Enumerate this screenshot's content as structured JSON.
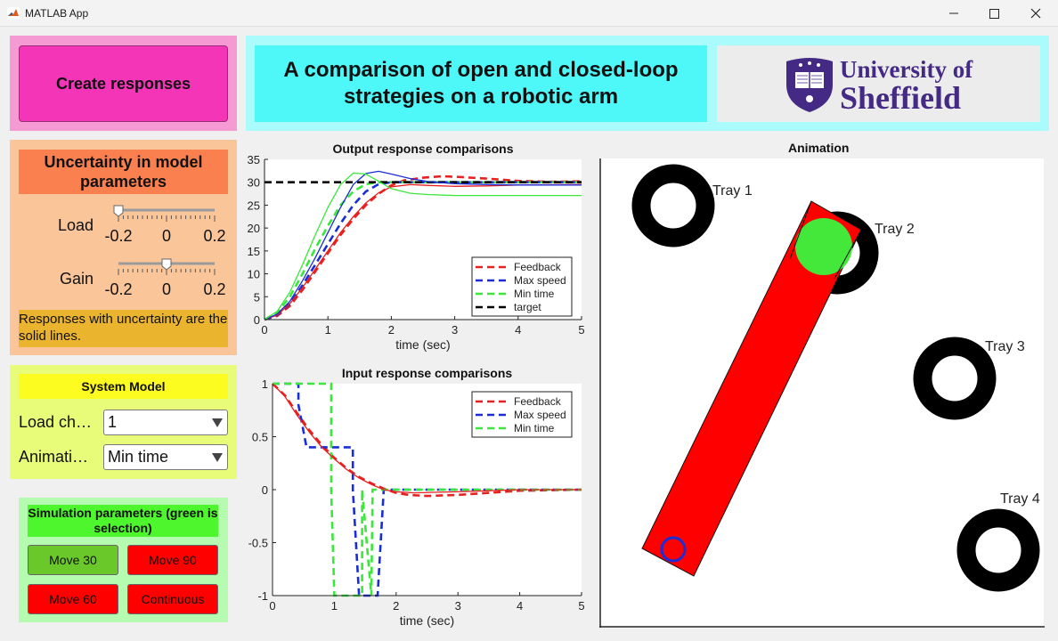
{
  "window": {
    "title": "MATLAB App"
  },
  "create_button": {
    "label": "Create responses"
  },
  "uncertainty": {
    "heading": "Uncertainty in model parameters",
    "load_label": "Load",
    "gain_label": "Gain",
    "slider_ticks": [
      "-0.2",
      "0",
      "0.2"
    ],
    "load_value": -0.2,
    "gain_value": 0,
    "note": "Responses with uncertainty are the solid lines."
  },
  "system_model": {
    "heading": "System Model",
    "load_label": "Load ch…",
    "load_value": "1",
    "anim_label": "Animati…",
    "anim_value": "Min time"
  },
  "simulation": {
    "heading": "Simulation parameters (green is selection)",
    "buttons": [
      "Move 30",
      "Move 90",
      "Move 60",
      "Continuous"
    ],
    "colors": {
      "selected": "#6ac82b",
      "unselected": "#ff0000"
    }
  },
  "header": {
    "title": "A comparison of open and closed-loop strategies on a robotic arm",
    "logo_line1": "University of",
    "logo_line2": "Sheffield"
  },
  "colors": {
    "feedback": "#e82020",
    "max_speed": "#1a2ed8",
    "min_time": "#3ae83a",
    "target": "#000000"
  },
  "chart_data": [
    {
      "type": "line",
      "title": "Output response comparisons",
      "xlabel": "time (sec)",
      "ylabel": "",
      "xlim": [
        0,
        5
      ],
      "ylim": [
        0,
        35
      ],
      "xticks": [
        "0",
        "1",
        "2",
        "3",
        "4",
        "5"
      ],
      "yticks": [
        "0",
        "5",
        "10",
        "15",
        "20",
        "25",
        "30",
        "35"
      ],
      "legend": [
        "Feedback",
        "Max speed",
        "Min time",
        "target"
      ],
      "legend_position": "bottom-right",
      "series": [
        {
          "name": "Feedback",
          "style": "dashed",
          "x": [
            0,
            0.2,
            0.4,
            0.6,
            0.8,
            1.0,
            1.2,
            1.4,
            1.6,
            1.8,
            2.0,
            2.2,
            2.5,
            2.8,
            3.0,
            3.5,
            4.0,
            4.5,
            5.0
          ],
          "y": [
            0,
            0.8,
            3,
            6.5,
            10.5,
            14.5,
            18.5,
            22,
            25,
            27.5,
            29.3,
            30.4,
            31,
            31.3,
            31.2,
            30.8,
            30.3,
            30.1,
            30.2
          ]
        },
        {
          "name": "Max speed",
          "style": "dashed",
          "x": [
            0,
            0.2,
            0.4,
            0.6,
            0.8,
            1.0,
            1.2,
            1.4,
            1.6,
            1.8,
            2.0,
            2.5,
            3.0,
            4.0,
            5.0
          ],
          "y": [
            0,
            1,
            3.5,
            7.5,
            12,
            16.5,
            21,
            25,
            28,
            29.6,
            30,
            30,
            30,
            30,
            30
          ]
        },
        {
          "name": "Min time",
          "style": "dashed",
          "x": [
            0,
            0.2,
            0.4,
            0.6,
            0.8,
            1.0,
            1.2,
            1.4,
            1.6,
            1.8,
            2.0,
            2.5,
            3.0,
            4.0,
            5.0
          ],
          "y": [
            0,
            1.5,
            5,
            10,
            15.5,
            20.5,
            25,
            28,
            29.6,
            30,
            30,
            30,
            30,
            30,
            30
          ]
        },
        {
          "name": "target",
          "style": "dashed",
          "x": [
            0,
            5
          ],
          "y": [
            30,
            30
          ]
        },
        {
          "name": "Feedback (uncertain)",
          "style": "solid",
          "x": [
            0,
            0.2,
            0.4,
            0.6,
            0.8,
            1.0,
            1.2,
            1.4,
            1.6,
            1.8,
            2.0,
            2.3,
            2.6,
            3.0,
            3.5,
            4.0,
            5.0
          ],
          "y": [
            0,
            1,
            3.5,
            7,
            11,
            15,
            19,
            22.5,
            25.5,
            27.7,
            29,
            29.5,
            29.3,
            29.1,
            29.2,
            29.4,
            29.5
          ]
        },
        {
          "name": "Max speed (uncertain)",
          "style": "solid",
          "x": [
            0,
            0.2,
            0.4,
            0.6,
            0.8,
            1.0,
            1.2,
            1.4,
            1.6,
            1.8,
            2.0,
            2.3,
            2.6,
            3.0,
            3.5,
            4.0,
            5.0
          ],
          "y": [
            0,
            1.2,
            4,
            8.5,
            13.5,
            19,
            24.5,
            29.5,
            31.9,
            32.4,
            31.8,
            30.8,
            30.1,
            29.7,
            29.5,
            29.4,
            29.4
          ]
        },
        {
          "name": "Min time (uncertain)",
          "style": "solid",
          "x": [
            0,
            0.2,
            0.4,
            0.6,
            0.8,
            1.0,
            1.2,
            1.4,
            1.6,
            1.8,
            2.0,
            2.3,
            2.6,
            3.0,
            3.5,
            4.0,
            5.0
          ],
          "y": [
            0,
            1.8,
            6,
            12,
            18.5,
            24.5,
            29.5,
            32,
            31.8,
            30.2,
            28.6,
            27.6,
            27.3,
            27.1,
            27.1,
            27.1,
            27.1
          ]
        }
      ]
    },
    {
      "type": "line",
      "title": "Input response comparisons",
      "xlabel": "time (sec)",
      "ylabel": "",
      "xlim": [
        0,
        5
      ],
      "ylim": [
        -1,
        1
      ],
      "xticks": [
        "0",
        "1",
        "2",
        "3",
        "4",
        "5"
      ],
      "yticks": [
        "-1",
        "-0.5",
        "0",
        "0.5",
        "1"
      ],
      "legend": [
        "Feedback",
        "Max speed",
        "Min time"
      ],
      "legend_position": "top-right",
      "series": [
        {
          "name": "Feedback",
          "style": "dashed",
          "x": [
            0,
            0.2,
            0.4,
            0.6,
            0.8,
            1.0,
            1.2,
            1.4,
            1.6,
            1.8,
            2.0,
            2.2,
            2.5,
            3.0,
            3.5,
            4.0,
            5.0
          ],
          "y": [
            1,
            0.89,
            0.72,
            0.56,
            0.42,
            0.3,
            0.2,
            0.12,
            0.06,
            0.01,
            -0.03,
            -0.05,
            -0.06,
            -0.05,
            -0.03,
            -0.01,
            0
          ]
        },
        {
          "name": "Max speed",
          "style": "dashed",
          "x": [
            0,
            0.42,
            0.42,
            0.55,
            0.55,
            1.3,
            1.3,
            1.4,
            1.4,
            1.7,
            1.8,
            5.0
          ],
          "y": [
            1,
            1,
            0.8,
            0.4,
            0.4,
            0.4,
            0,
            -1,
            -1,
            -1,
            0,
            0
          ]
        },
        {
          "name": "Min time",
          "style": "dashed",
          "x": [
            0,
            0.95,
            0.95,
            1.0,
            1.0,
            1.45,
            1.45,
            1.6,
            1.62,
            5.0
          ],
          "y": [
            1,
            1,
            0,
            -1,
            -1,
            -1,
            0,
            -1,
            0,
            0
          ]
        },
        {
          "name": "Feedback (uncertain)",
          "style": "solid",
          "x": [
            0,
            0.2,
            0.4,
            0.6,
            0.8,
            1.0,
            1.2,
            1.4,
            1.6,
            1.8,
            2.0,
            2.3,
            2.6,
            3.0,
            3.5,
            4.0,
            5.0
          ],
          "y": [
            1,
            0.88,
            0.7,
            0.54,
            0.4,
            0.29,
            0.19,
            0.11,
            0.05,
            0.0,
            -0.02,
            -0.03,
            -0.025,
            -0.02,
            -0.01,
            0,
            0
          ]
        }
      ]
    }
  ],
  "animation": {
    "title": "Animation",
    "trays": [
      "Tray 1",
      "Tray 2",
      "Tray 3",
      "Tray 4"
    ]
  }
}
